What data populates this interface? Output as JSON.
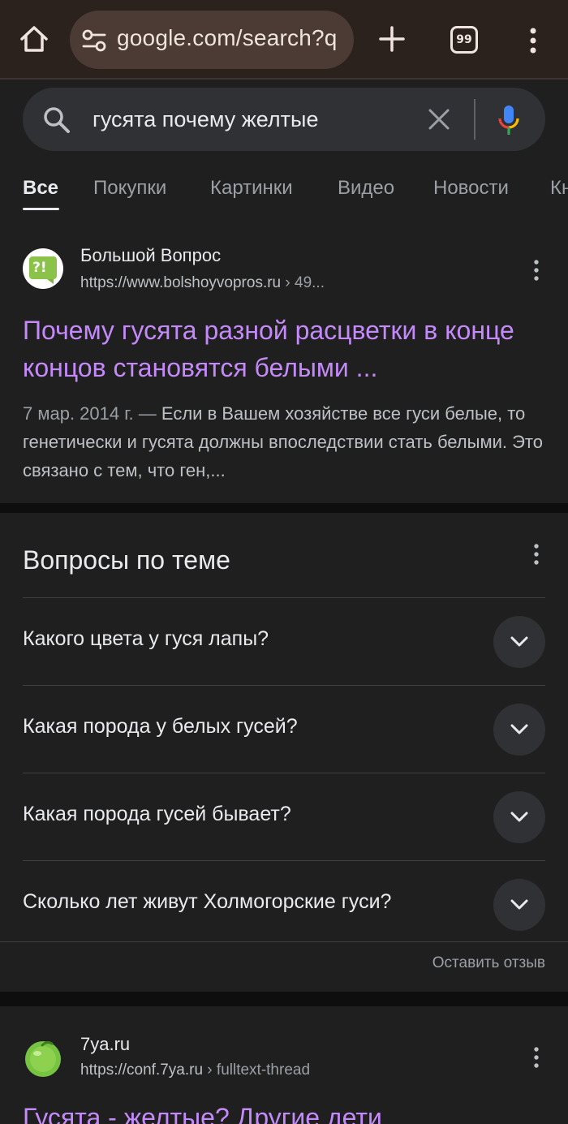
{
  "browser": {
    "url_text": "google.com/search?q",
    "tab_count": "99",
    "icons": [
      "home-icon",
      "site-settings-icon",
      "plus-icon",
      "tab-switcher-icon",
      "overflow-menu-icon"
    ]
  },
  "search": {
    "query": "гусята почему желтые",
    "icons": [
      "search-icon",
      "clear-icon",
      "mic-icon"
    ]
  },
  "tabs": [
    {
      "label": "Все",
      "active": true
    },
    {
      "label": "Покупки"
    },
    {
      "label": "Картинки"
    },
    {
      "label": "Видео"
    },
    {
      "label": "Новости"
    },
    {
      "label": "Кн"
    }
  ],
  "result1": {
    "site_name": "Большой Вопрос",
    "url": "https://www.bolshoyvopros.ru",
    "crumb": " › 49...",
    "favicon_text": "?!",
    "title": "Почему гусята разной расцветки в конце концов становятся белыми ...",
    "date": "7 мар. 2014 г. — ",
    "snippet": "Если в Вашем хозяйстве все гуси белые, то генетически и гусята должны впоследствии стать белыми. Это связано с тем, что ген,..."
  },
  "paa": {
    "title": "Вопросы по теме",
    "questions": [
      "Какого цвета у гуся лапы?",
      "Какая порода у белых гусей?",
      "Какая порода гусей бывает?",
      "Сколько лет живут Холмогорские гуси?"
    ],
    "feedback": "Оставить отзыв"
  },
  "result2": {
    "site_name": "7ya.ru",
    "url": "https://conf.7ya.ru",
    "crumb": " › fulltext-thread",
    "title": "Гусята - желтые? Другие дети"
  },
  "colors": {
    "toolbar_bg": "#2b211d",
    "omnibox_bg": "#4c3b34",
    "page_bg": "#1f1f1f",
    "visited_link": "#c58af9"
  }
}
